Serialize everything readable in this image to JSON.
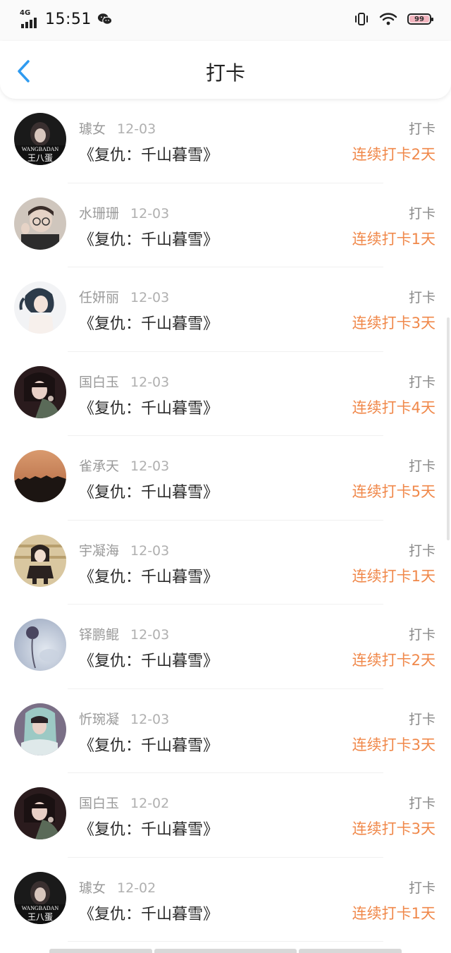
{
  "status_bar": {
    "network": "4G",
    "time": "15:51",
    "battery": "99"
  },
  "nav": {
    "title": "打卡",
    "back_icon": "chevron-left-icon"
  },
  "entries": [
    {
      "user": "璩女",
      "date": "12-03",
      "book": "《复仇：千山暮雪》",
      "action": "打卡",
      "streak": "连续打卡2天",
      "avatar": "wangbadan"
    },
    {
      "user": "水珊珊",
      "date": "12-03",
      "book": "《复仇：千山暮雪》",
      "action": "打卡",
      "streak": "连续打卡1天",
      "avatar": "boy-glasses"
    },
    {
      "user": "任妍丽",
      "date": "12-03",
      "book": "《复仇：千山暮雪》",
      "action": "打卡",
      "streak": "连续打卡3天",
      "avatar": "anime-girl"
    },
    {
      "user": "国白玉",
      "date": "12-03",
      "book": "《复仇：千山暮雪》",
      "action": "打卡",
      "streak": "连续打卡4天",
      "avatar": "girl-dark"
    },
    {
      "user": "雀承天",
      "date": "12-03",
      "book": "《复仇：千山暮雪》",
      "action": "打卡",
      "streak": "连续打卡5天",
      "avatar": "sunset"
    },
    {
      "user": "宇凝海",
      "date": "12-03",
      "book": "《复仇：千山暮雪》",
      "action": "打卡",
      "streak": "连续打卡1天",
      "avatar": "cartoon-girl"
    },
    {
      "user": "铎鹏鲲",
      "date": "12-03",
      "book": "《复仇：千山暮雪》",
      "action": "打卡",
      "streak": "连续打卡2天",
      "avatar": "flower-blue"
    },
    {
      "user": "忻琬凝",
      "date": "12-03",
      "book": "《复仇：千山暮雪》",
      "action": "打卡",
      "streak": "连续打卡3天",
      "avatar": "girl-teal"
    },
    {
      "user": "国白玉",
      "date": "12-02",
      "book": "《复仇：千山暮雪》",
      "action": "打卡",
      "streak": "连续打卡3天",
      "avatar": "girl-dark"
    },
    {
      "user": "璩女",
      "date": "12-02",
      "book": "《复仇：千山暮雪》",
      "action": "打卡",
      "streak": "连续打卡1天",
      "avatar": "wangbadan"
    }
  ],
  "colors": {
    "streak": "#f0884a",
    "back": "#2f9bf0"
  }
}
